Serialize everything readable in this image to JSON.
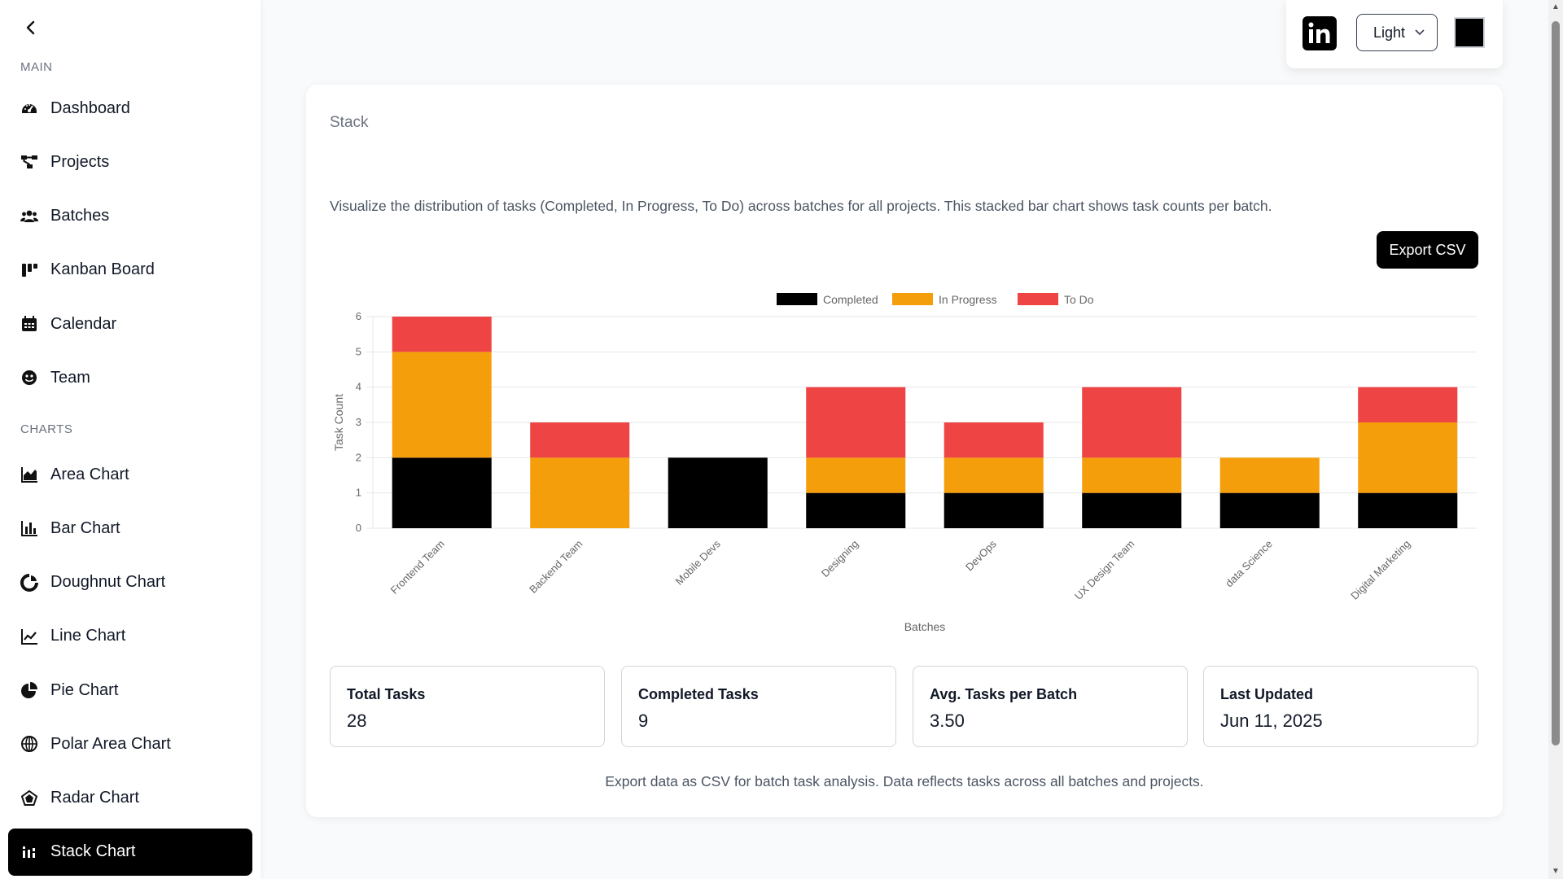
{
  "sidebar": {
    "main_label": "MAIN",
    "charts_label": "CHARTS",
    "main_items": [
      {
        "label": "Dashboard",
        "icon": "gauge-icon"
      },
      {
        "label": "Projects",
        "icon": "sitemap-icon"
      },
      {
        "label": "Batches",
        "icon": "users-icon"
      },
      {
        "label": "Kanban Board",
        "icon": "kanban-icon"
      },
      {
        "label": "Calendar",
        "icon": "calendar-icon"
      },
      {
        "label": "Team",
        "icon": "team-icon"
      }
    ],
    "chart_items": [
      {
        "label": "Area Chart",
        "icon": "area-chart-icon"
      },
      {
        "label": "Bar Chart",
        "icon": "bar-chart-icon"
      },
      {
        "label": "Doughnut Chart",
        "icon": "doughnut-chart-icon"
      },
      {
        "label": "Line Chart",
        "icon": "line-chart-icon"
      },
      {
        "label": "Pie Chart",
        "icon": "pie-chart-icon"
      },
      {
        "label": "Polar Area Chart",
        "icon": "polar-area-icon"
      },
      {
        "label": "Radar Chart",
        "icon": "radar-chart-icon"
      },
      {
        "label": "Stack Chart",
        "icon": "stack-chart-icon",
        "active": true
      }
    ]
  },
  "toolbar": {
    "theme_value": "Light",
    "swatch_color": "#000000"
  },
  "card": {
    "title": "Stack",
    "description": "Visualize the distribution of tasks (Completed, In Progress, To Do) across batches for all projects. This stacked bar chart shows task counts per batch.",
    "export_label": "Export CSV",
    "footer": "Export data as CSV for batch task analysis. Data reflects tasks across all batches and projects."
  },
  "stats": [
    {
      "label": "Total Tasks",
      "value": "28"
    },
    {
      "label": "Completed Tasks",
      "value": "9"
    },
    {
      "label": "Avg. Tasks per Batch",
      "value": "3.50"
    },
    {
      "label": "Last Updated",
      "value": "Jun 11, 2025"
    }
  ],
  "chart_data": {
    "type": "bar",
    "stacked": true,
    "categories": [
      "Frontend Team",
      "Backend Team",
      "Mobile Devs",
      "Designing",
      "DevOps",
      "UX Design Team",
      "data Science",
      "Digital Marketing"
    ],
    "series": [
      {
        "name": "Completed",
        "color": "#000000",
        "values": [
          2,
          0,
          2,
          1,
          1,
          1,
          1,
          1
        ]
      },
      {
        "name": "In Progress",
        "color": "#f59e0b",
        "values": [
          3,
          2,
          0,
          1,
          1,
          1,
          1,
          2
        ]
      },
      {
        "name": "To Do",
        "color": "#ef4444",
        "values": [
          1,
          1,
          0,
          2,
          1,
          2,
          0,
          1
        ]
      }
    ],
    "xlabel": "Batches",
    "ylabel": "Task Count",
    "ylim": [
      0,
      6
    ],
    "yticks": [
      0,
      1,
      2,
      3,
      4,
      5,
      6
    ],
    "legend_position": "top-center",
    "grid": true
  }
}
